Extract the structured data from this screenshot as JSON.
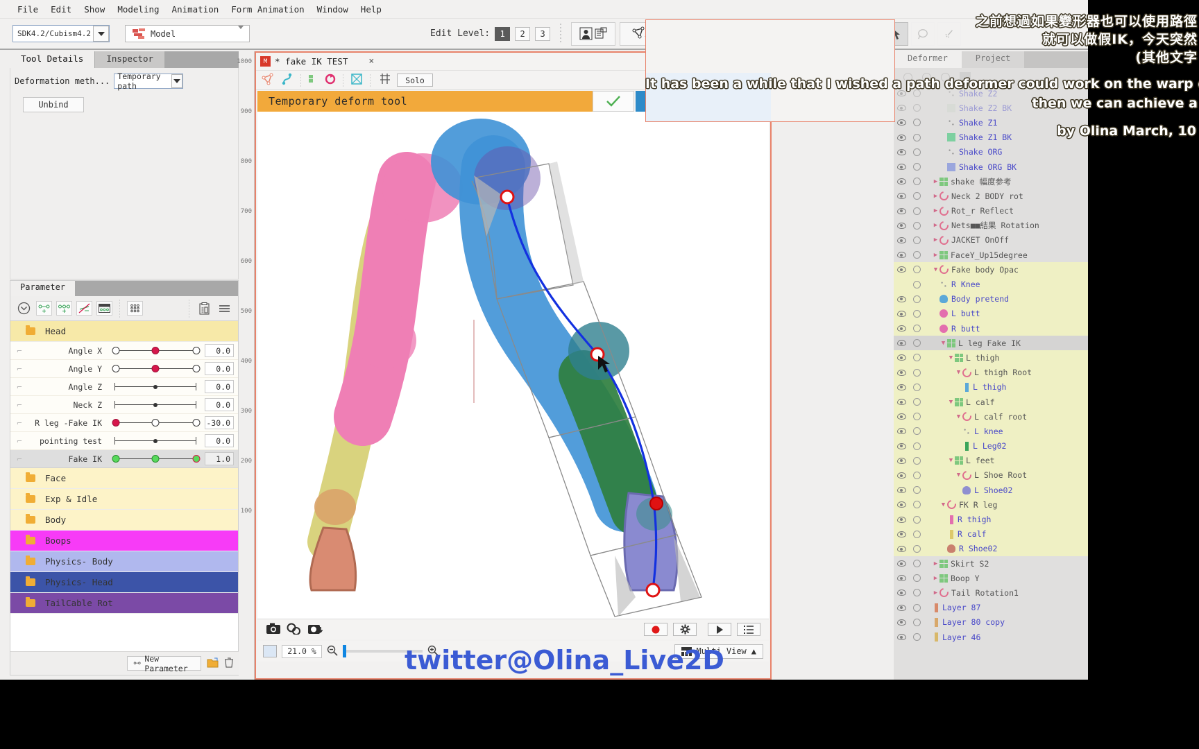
{
  "menubar": {
    "items": [
      "File",
      "Edit",
      "Show",
      "Modeling",
      "Animation",
      "Form Animation",
      "Window",
      "Help"
    ]
  },
  "toolbar": {
    "sdk_value": "SDK4.2/Cubism4.2",
    "model_label": "Model",
    "edit_level_label": "Edit Level:",
    "levels": [
      "1",
      "2",
      "3"
    ],
    "active_level": "1"
  },
  "left_panel": {
    "tabs": [
      {
        "label": "Tool Details",
        "active": true
      },
      {
        "label": "Inspector",
        "active": false
      }
    ],
    "deform_method_label": "Deformation meth...",
    "deform_method_value": "Temporary path",
    "unbind_label": "Unbind"
  },
  "parameter_panel": {
    "tab_label": "Parameter",
    "new_parameter_label": "New Parameter",
    "rows": [
      {
        "type": "group",
        "name": "Head",
        "color": "#f7e9a8"
      },
      {
        "type": "param",
        "name": "Angle X",
        "value": "0.0",
        "knob": "red",
        "pos": 52,
        "ends": "hollow"
      },
      {
        "type": "param",
        "name": "Angle Y",
        "value": "0.0",
        "knob": "red",
        "pos": 52,
        "ends": "hollow"
      },
      {
        "type": "param",
        "name": "Angle Z",
        "value": "0.0",
        "knob": "dot",
        "pos": 50,
        "ends": "cap"
      },
      {
        "type": "param",
        "name": "Neck Z",
        "value": "0.0",
        "knob": "dot",
        "pos": 50,
        "ends": "cap"
      },
      {
        "type": "param",
        "name": "R leg -Fake IK",
        "value": "-30.0",
        "knob": "red",
        "pos": 2,
        "ends": "hollow"
      },
      {
        "type": "param",
        "name": "pointing test",
        "value": "0.0",
        "knob": "dot",
        "pos": 50,
        "ends": "cap"
      },
      {
        "type": "param",
        "name": "Fake IK",
        "value": "1.0",
        "knob": "greenred",
        "pos": 99,
        "ends": "green",
        "selected": true
      },
      {
        "type": "group",
        "name": "Face",
        "color": "#fdf3c8"
      },
      {
        "type": "group",
        "name": "Exp & Idle",
        "color": "#fdf3c8"
      },
      {
        "type": "group",
        "name": "Body",
        "color": "#fdf3c8"
      },
      {
        "type": "group",
        "name": "Boops",
        "color": "#f73bf7"
      },
      {
        "type": "group",
        "name": "Physics- Body",
        "color": "#b0b8ee"
      },
      {
        "type": "group",
        "name": "Physics- Head",
        "color": "#3c54a8"
      },
      {
        "type": "group",
        "name": "TailCable Rot",
        "color": "#7b4aa6"
      }
    ]
  },
  "document": {
    "tab_title": "* fake IK TEST",
    "solo_label": "Solo",
    "temp_tool_label": "Temporary deform tool",
    "zoom_value": "21.0 %",
    "multi_view_label": "Multi View",
    "ruler_ticks": [
      "1000",
      "900",
      "800",
      "700",
      "600",
      "500",
      "400",
      "300",
      "200",
      "100"
    ]
  },
  "right_panel": {
    "tabs": [
      {
        "label": "Deformer",
        "active": true
      },
      {
        "label": "Project",
        "active": false
      }
    ],
    "nodes": [
      {
        "name": "Shake Z2",
        "indent": 3,
        "type": "leaf",
        "dim": true
      },
      {
        "name": "Shake Z2 BK",
        "indent": 3,
        "type": "swatch",
        "color": "#cfd8cd",
        "dim": true
      },
      {
        "name": "Shake Z1",
        "indent": 3,
        "type": "leaf"
      },
      {
        "name": "Shake Z1 BK",
        "indent": 3,
        "type": "swatch",
        "color": "#7dd0a0"
      },
      {
        "name": "Shake ORG",
        "indent": 3,
        "type": "leaf"
      },
      {
        "name": "Shake ORG BK",
        "indent": 3,
        "type": "swatch",
        "color": "#9aa6dd"
      },
      {
        "name": "shake 幅度参考",
        "indent": 1,
        "type": "group",
        "collapsed": true
      },
      {
        "name": "Neck 2 BODY rot",
        "indent": 1,
        "type": "rot",
        "collapsed": true
      },
      {
        "name": "Rot_r  Reflect",
        "indent": 1,
        "type": "rot",
        "collapsed": true
      },
      {
        "name": "Nets■■結果 Rotation",
        "indent": 1,
        "type": "rot",
        "collapsed": true
      },
      {
        "name": "JACKET OnOff",
        "indent": 1,
        "type": "rot",
        "collapsed": true
      },
      {
        "name": "FaceY_Up15degree",
        "indent": 1,
        "type": "group",
        "collapsed": true
      },
      {
        "name": "Fake body Opac",
        "indent": 1,
        "type": "rot",
        "expanded": true,
        "hl": true
      },
      {
        "name": "R Knee",
        "indent": 2,
        "type": "dots",
        "hl": true,
        "noeye": true
      },
      {
        "name": "Body pretend",
        "indent": 2,
        "type": "shape",
        "color": "#5ba8d8",
        "hl": true
      },
      {
        "name": "L butt",
        "indent": 2,
        "type": "circle",
        "color": "#e36fae",
        "hl": true
      },
      {
        "name": "R butt",
        "indent": 2,
        "type": "circle",
        "color": "#e36fae",
        "hl": true
      },
      {
        "name": "L leg Fake IK",
        "indent": 2,
        "type": "group",
        "expanded": true,
        "hl": true,
        "selected": true
      },
      {
        "name": "L thigh",
        "indent": 3,
        "type": "group",
        "expanded": true,
        "hl": true
      },
      {
        "name": "L thigh Root",
        "indent": 4,
        "type": "rot",
        "expanded": true,
        "hl": true
      },
      {
        "name": "L thigh",
        "indent": 5,
        "type": "bar",
        "color": "#5ba8d8",
        "hl": true
      },
      {
        "name": "L calf",
        "indent": 3,
        "type": "group",
        "expanded": true,
        "hl": true
      },
      {
        "name": "L calf root",
        "indent": 4,
        "type": "rot",
        "expanded": true,
        "hl": true
      },
      {
        "name": "L knee",
        "indent": 5,
        "type": "dots",
        "hl": true
      },
      {
        "name": "L Leg02",
        "indent": 5,
        "type": "bar",
        "color": "#3aa55a",
        "hl": true
      },
      {
        "name": "L feet",
        "indent": 3,
        "type": "group",
        "expanded": true,
        "hl": true
      },
      {
        "name": "L Shoe Root",
        "indent": 4,
        "type": "rot",
        "expanded": true,
        "hl": true
      },
      {
        "name": "L Shoe02",
        "indent": 5,
        "type": "shape",
        "color": "#8f8fd0",
        "hl": true
      },
      {
        "name": "FK R leg",
        "indent": 2,
        "type": "rot",
        "expanded": true,
        "hl": true
      },
      {
        "name": "R thigh",
        "indent": 3,
        "type": "bar",
        "color": "#e36fae",
        "hl": true
      },
      {
        "name": "R calf",
        "indent": 3,
        "type": "bar",
        "color": "#ddc96a",
        "hl": true
      },
      {
        "name": "R Shoe02",
        "indent": 3,
        "type": "shape",
        "color": "#c9806e",
        "hl": true
      },
      {
        "name": "Skirt S2",
        "indent": 1,
        "type": "group",
        "collapsed": true
      },
      {
        "name": "Boop Y",
        "indent": 1,
        "type": "group",
        "collapsed": true
      },
      {
        "name": "Tail Rotation1",
        "indent": 1,
        "type": "rot",
        "collapsed": true
      },
      {
        "name": "Layer 87",
        "indent": 1,
        "type": "bar",
        "color": "#d88a6a"
      },
      {
        "name": "Layer 80 copy",
        "indent": 1,
        "type": "bar",
        "color": "#d8a86a"
      },
      {
        "name": "Layer 46",
        "indent": 1,
        "type": "bar",
        "color": "#d8b86a"
      }
    ]
  },
  "overlay": {
    "cn_line1": "之前想過如果變形器也可以使用路徑",
    "cn_line2": "就可以做假IK，今天突然",
    "cn_line3": "(其他文字",
    "en_line1": "It has been a while that I wished a path deformer could work on the warp d",
    "en_line2": "then we can achieve a",
    "credit": "by Olina March, 10",
    "watermark": "twitter@Olina_Live2D"
  }
}
